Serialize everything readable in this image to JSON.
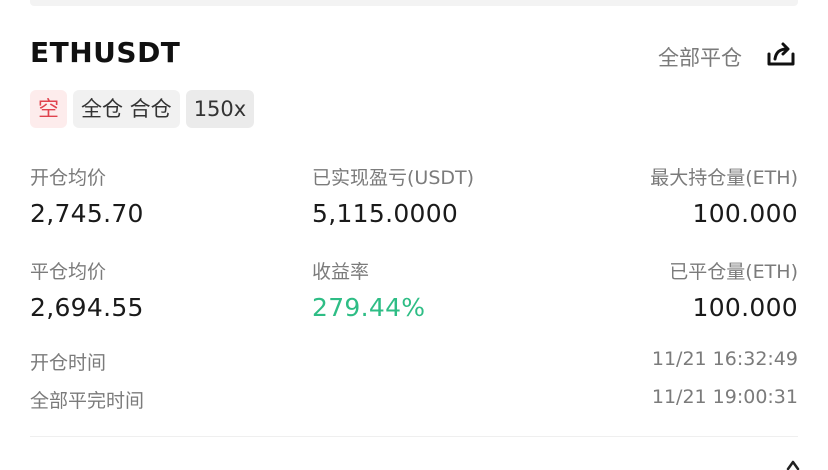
{
  "position": {
    "symbol": "ETHUSDT",
    "close_all_label": "全部平仓",
    "share_icon": "share-icon",
    "tags": {
      "side": "空",
      "margin_mode": "全仓 合仓",
      "leverage": "150x"
    }
  },
  "stats": {
    "open_avg_price": {
      "label": "开仓均价",
      "value": "2,745.70"
    },
    "realized_pnl": {
      "label": "已实现盈亏(USDT)",
      "value": "5,115.0000"
    },
    "max_position": {
      "label": "最大持仓量(ETH)",
      "value": "100.000"
    },
    "close_avg_price": {
      "label": "平仓均价",
      "value": "2,694.55"
    },
    "roi": {
      "label": "收益率",
      "value": "279.44%"
    },
    "closed_qty": {
      "label": "已平仓量(ETH)",
      "value": "100.000"
    },
    "open_time": {
      "label": "开仓时间",
      "value": "11/21 16:32:49"
    },
    "full_close_time": {
      "label": "全部平完时间",
      "value": "11/21 19:00:31"
    }
  },
  "colors": {
    "short": "#e0434e",
    "profit": "#2ebd85",
    "muted": "#7b7b7b"
  }
}
